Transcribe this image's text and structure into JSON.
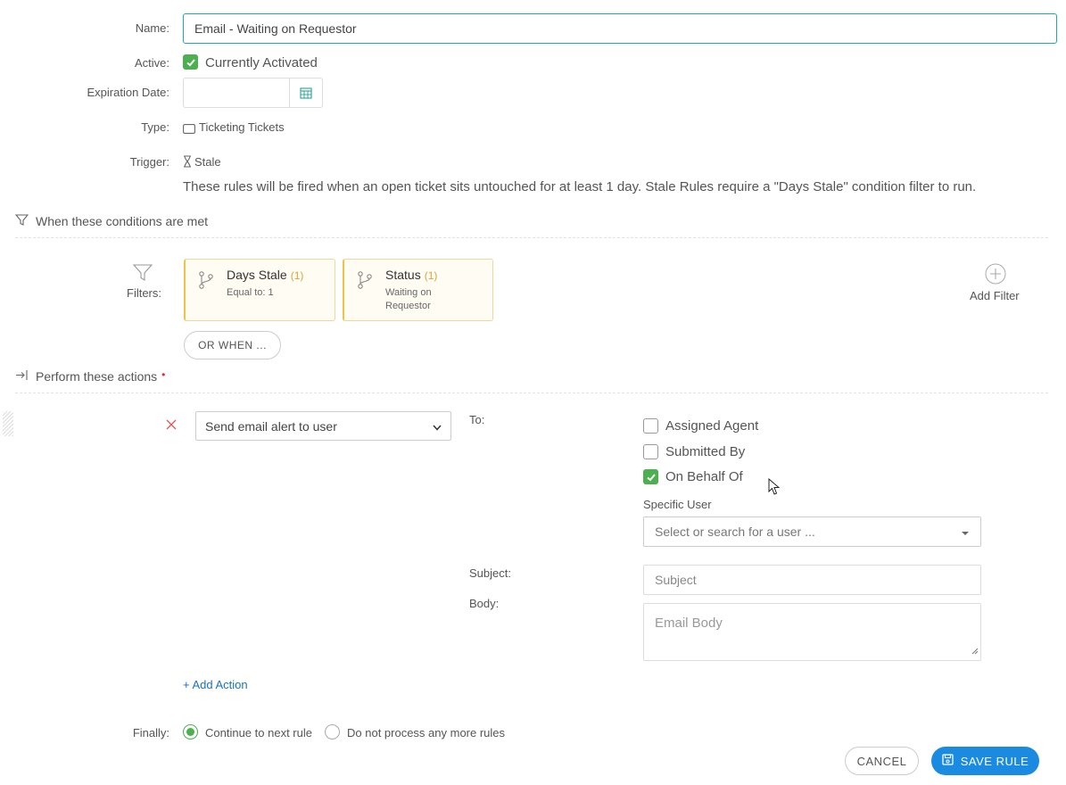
{
  "form": {
    "name_label": "Name:",
    "name_value": "Email - Waiting on Requestor",
    "active_label": "Active:",
    "active_text": "Currently Activated",
    "expiration_label": "Expiration Date:",
    "type_label": "Type:",
    "type_value": "Ticketing Tickets",
    "trigger_label": "Trigger:",
    "trigger_value": "Stale",
    "trigger_description": "These rules will be fired when an open ticket sits untouched for at least 1 day. Stale Rules require a \"Days Stale\" condition filter to run."
  },
  "conditions": {
    "heading": "When these conditions are met",
    "filters_label": "Filters:",
    "filters": [
      {
        "title": "Days Stale",
        "count": "(1)",
        "detail": "Equal to: 1"
      },
      {
        "title": "Status",
        "count": "(1)",
        "detail": "Waiting on Requestor"
      }
    ],
    "add_filter_label": "Add Filter",
    "or_when_label": "OR WHEN ..."
  },
  "actions": {
    "heading": "Perform these actions",
    "required_marker": "•",
    "action_select": "Send email alert to user",
    "to_label": "To:",
    "recipients": [
      {
        "label": "Assigned Agent",
        "checked": false
      },
      {
        "label": "Submitted By",
        "checked": false
      },
      {
        "label": "On Behalf Of",
        "checked": true
      }
    ],
    "specific_user_label": "Specific User",
    "specific_user_placeholder": "Select or search for a user ...",
    "subject_label": "Subject:",
    "subject_placeholder": "Subject",
    "body_label": "Body:",
    "body_placeholder": "Email Body",
    "add_action_label": "+ Add Action"
  },
  "finally": {
    "label": "Finally:",
    "options": [
      {
        "label": "Continue to next rule",
        "selected": true
      },
      {
        "label": "Do not process any more rules",
        "selected": false
      }
    ]
  },
  "buttons": {
    "cancel": "CANCEL",
    "save": "SAVE RULE"
  },
  "colors": {
    "accent": "#1a8be0",
    "check_green": "#4caf50",
    "input_focus": "#1ba9b5",
    "filter_border": "#f0c24a",
    "remove_red": "#e05555"
  }
}
